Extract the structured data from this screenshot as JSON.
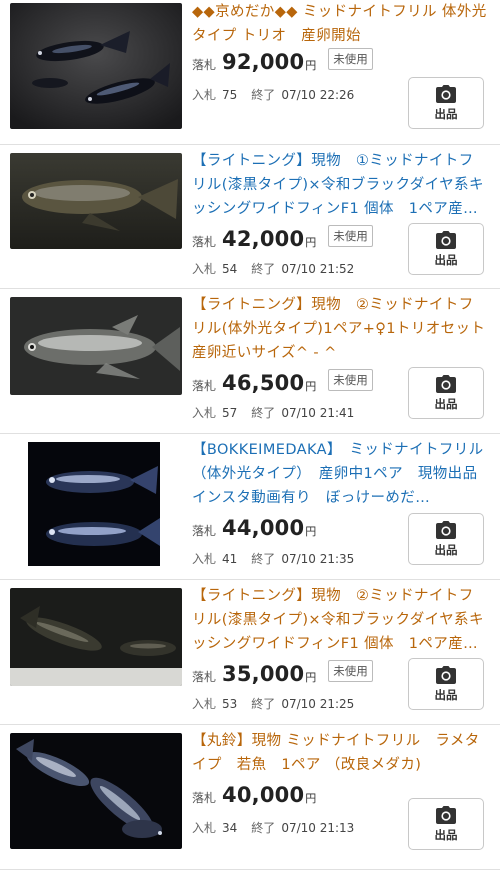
{
  "ui": {
    "price_label": "落札",
    "yen": "円",
    "bids_label": "入札",
    "end_label": "終了",
    "listing_button_label": "出品",
    "camera_icon": "camera-icon"
  },
  "colors": {
    "title_orange": "#b8660b",
    "title_blue": "#1c6fb5",
    "price": "#222222"
  },
  "items": [
    {
      "title": "◆◆京めだか◆◆ ミッドナイトフリル 体外光タイプ トリオ　産卵開始",
      "title_color": "orange",
      "price": "92,000",
      "badge": "未使用",
      "bids": "75",
      "end": "07/10 22:26"
    },
    {
      "title": "【ライトニング】現物　①ミッドナイトフリル(漆黒タイプ)×令和ブラックダイヤ系キッシングワイドフィンF1 個体　1ペア産…",
      "title_color": "blue",
      "price": "42,000",
      "badge": "未使用",
      "bids": "54",
      "end": "07/10 21:52"
    },
    {
      "title": "【ライトニング】現物　②ミッドナイトフリル(体外光タイプ)1ペア+♀1トリオセット産卵近いサイズ^ - ^",
      "title_color": "orange",
      "price": "46,500",
      "badge": "未使用",
      "bids": "57",
      "end": "07/10 21:41"
    },
    {
      "title": "【BOKKEIMEDAKA】　ミッドナイトフリル（体外光タイプ）　産卵中1ペア　現物出品　インスタ動画有り　ぼっけーめだ…",
      "title_color": "blue",
      "price": "44,000",
      "badge": "",
      "bids": "41",
      "end": "07/10 21:35"
    },
    {
      "title": "【ライトニング】現物　②ミッドナイトフリル(漆黒タイプ)×令和ブラックダイヤ系キッシングワイドフィンF1 個体　1ペア産…",
      "title_color": "orange",
      "price": "35,000",
      "badge": "未使用",
      "bids": "53",
      "end": "07/10 21:25"
    },
    {
      "title": "【丸鈴】現物 ミッドナイトフリル　ラメタイプ　若魚　1ペア （改良メダカ)",
      "title_color": "orange",
      "price": "40,000",
      "badge": "",
      "bids": "34",
      "end": "07/10 21:13"
    }
  ]
}
